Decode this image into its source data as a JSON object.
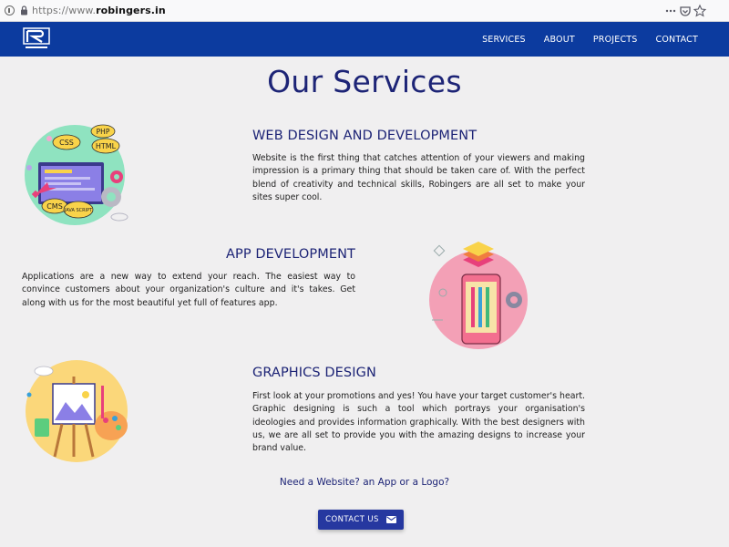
{
  "browser": {
    "url_scheme": "https://www.",
    "url_host": "robingers.in"
  },
  "nav": {
    "items": [
      "SERVICES",
      "ABOUT",
      "PROJECTS",
      "CONTACT"
    ]
  },
  "page_title": "Our Services",
  "services": [
    {
      "title": "WEB DESIGN AND DEVELOPMENT",
      "description": "Website is the first thing that catches attention of your viewers and making impression is a primary thing that should be taken care of. With the perfect blend of creativity and technical skills, Robingers are all set to make your sites super cool.",
      "illustration_labels": [
        "PHP",
        "CSS",
        "HTML",
        "CMS",
        "JAVA SCRIPT"
      ]
    },
    {
      "title": "APP DEVELOPMENT",
      "description": "Applications are a new way to extend your reach. The easiest way to convince customers about your organization's culture and it's takes. Get along with us for the most beautiful yet full of features app."
    },
    {
      "title": "GRAPHICS DESIGN",
      "description": "First look at your promotions and yes! You have your target customer's heart. Graphic designing is such a tool which portrays your organisation's ideologies and provides information graphically. With the best designers with us, we are all set to provide you with the amazing designs to increase your brand value."
    }
  ],
  "cta": {
    "question": "Need a Website? an App or a Logo?",
    "button_label": "CONTACT US"
  },
  "colors": {
    "nav_bg": "#0c3b9f",
    "heading": "#1d2476",
    "button_bg": "#2638a0",
    "page_bg": "#f0eff0"
  }
}
